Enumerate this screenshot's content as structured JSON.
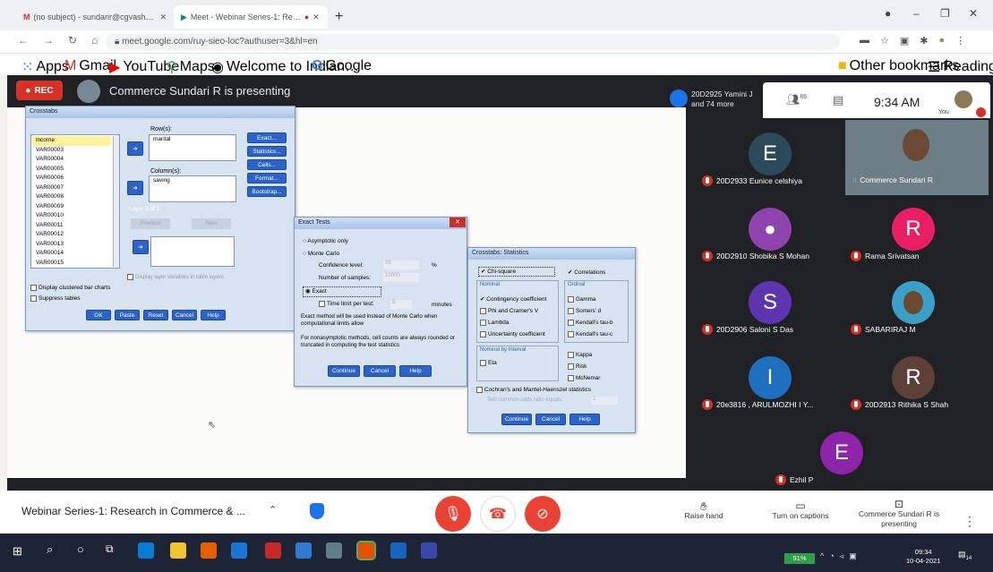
{
  "browser": {
    "tabs": [
      {
        "title": "(no subject) - sundarir@cgvash…"
      },
      {
        "title": "Meet - Webinar Series-1: Re…"
      }
    ],
    "url": "meet.google.com/ruy-sieo-loc?authuser=3&hl=en",
    "bookmarks": [
      "Apps",
      "Gmail",
      "YouTube",
      "Maps",
      "Welcome to Indian…",
      "Google"
    ],
    "other_bookmarks": "Other bookmarks",
    "reading_list": "Reading list"
  },
  "meet": {
    "rec_label": "REC",
    "presenting_text": "Commerce Sundari R is presenting",
    "viewers": {
      "line1": "20D2925 Yamini J",
      "line2": "and 74 more"
    },
    "people_count": "86",
    "time": "9:34 AM",
    "you_label": "You",
    "participants": [
      {
        "initial": "E",
        "name": "20D2933 Eunice celshiya",
        "color": "#2d4a5a"
      },
      {
        "initial": "",
        "name": "Commerce Sundari R",
        "color": "#6b5a4a"
      },
      {
        "initial": "",
        "name": "20D2910 Shobika S Mohan",
        "color": "#8e44ad"
      },
      {
        "initial": "R",
        "name": "Rama Srivatsan",
        "color": "#e91e63"
      },
      {
        "initial": "S",
        "name": "20D2906 Saloni S Das",
        "color": "#5e35b1"
      },
      {
        "initial": "",
        "name": "SABARIRAJ M",
        "color": "#3aa0c8"
      },
      {
        "initial": "I",
        "name": "20e3816 , ARULMOZHI I Y...",
        "color": "#1e6fc0"
      },
      {
        "initial": "R",
        "name": "20D2913 Rithika S Shah",
        "color": "#5d4037"
      },
      {
        "initial": "E",
        "name": "Ezhil P",
        "color": "#8e24aa"
      }
    ],
    "meeting_title": "Webinar Series-1: Research in Commerce & ...",
    "actions": [
      {
        "label": "Raise hand"
      },
      {
        "label": "Turn on captions"
      },
      {
        "label": "Commerce Sundari R is presenting"
      }
    ]
  },
  "spss": {
    "crosstabs": {
      "title": "Crosstabs",
      "variables": [
        "income",
        "VAR00003",
        "VAR00004",
        "VAR00005",
        "VAR00006",
        "VAR00007",
        "VAR00008",
        "VAR00009",
        "VAR00010",
        "VAR00011",
        "VAR00012",
        "VAR00013",
        "VAR00014",
        "VAR00015"
      ],
      "rows_label": "Row(s):",
      "row_var": "marital",
      "cols_label": "Column(s):",
      "col_var": "saving",
      "layer_label": "Layer 1 of 1",
      "layer_prev": "Previous",
      "layer_next": "Next",
      "side_buttons": [
        "Exact...",
        "Statistics...",
        "Cells...",
        "Format...",
        "Bootstrap..."
      ],
      "display_clustered": "Display clustered bar charts",
      "suppress": "Suppress tables",
      "layer_hint": "Display layer variables in table layers",
      "buttons": [
        "OK",
        "Paste",
        "Reset",
        "Cancel",
        "Help"
      ]
    },
    "exact": {
      "title": "Exact Tests",
      "asymptotic": "Asymptotic only",
      "monte_carlo": "Monte Carlo",
      "confidence": "Confidence level:",
      "confidence_val": "99",
      "percent": "%",
      "samples": "Number of samples:",
      "samples_val": "10000",
      "exact": "Exact",
      "time_limit": "Time limit per test:",
      "time_val": "5",
      "minutes": "minutes",
      "note1": "Exact method will be used instead of Monte Carlo when computational limits allow",
      "note2": "For nonasymptotic methods, cell counts are always rounded or truncated in computing the test statistics",
      "buttons": [
        "Continue",
        "Cancel",
        "Help"
      ]
    },
    "stats": {
      "title": "Crosstabs: Statistics",
      "chi": "Chi-square",
      "corr": "Correlations",
      "nominal_label": "Nominal",
      "nominal": [
        "Contingency coefficient",
        "Phi and Cramer's V",
        "Lambda",
        "Uncertainty coefficient"
      ],
      "ordinal_label": "Ordinal",
      "ordinal": [
        "Gamma",
        "Somers' d",
        "Kendall's tau-b",
        "Kendall's tau-c"
      ],
      "interval_label": "Nominal by Interval",
      "eta": "Eta",
      "other": [
        "Kappa",
        "Risk",
        "McNemar"
      ],
      "cmh": "Cochran's and Mantel-Haenszel statistics",
      "cmh_test": "Test common odds ratio equals:",
      "cmh_val": "1",
      "buttons": [
        "Continue",
        "Cancel",
        "Help"
      ]
    }
  },
  "taskbar": {
    "battery": "91%",
    "time": "09:34",
    "date": "10-04-2021",
    "notif": "14"
  }
}
